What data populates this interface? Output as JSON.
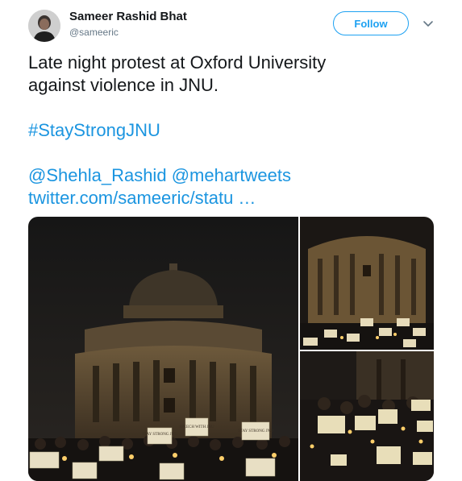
{
  "user": {
    "display_name": "Sameer Rashid Bhat",
    "handle": "@sameeric"
  },
  "actions": {
    "follow_label": "Follow"
  },
  "tweet": {
    "line1": "Late night protest at Oxford University",
    "line2": "against violence in JNU.",
    "hashtag": "#StayStrongJNU",
    "mention1": "@Shehla_Rashid",
    "mention2": "@mehartweets",
    "link": "twitter.com/sameeric/statu …"
  },
  "media": {
    "sign_texts": [
      "STAY STRONG JNU",
      "SPEECH WITH JNU",
      "STAY STRONG JNU"
    ]
  },
  "colors": {
    "link": "#1b95e0",
    "follow_border": "#1da1f2"
  }
}
